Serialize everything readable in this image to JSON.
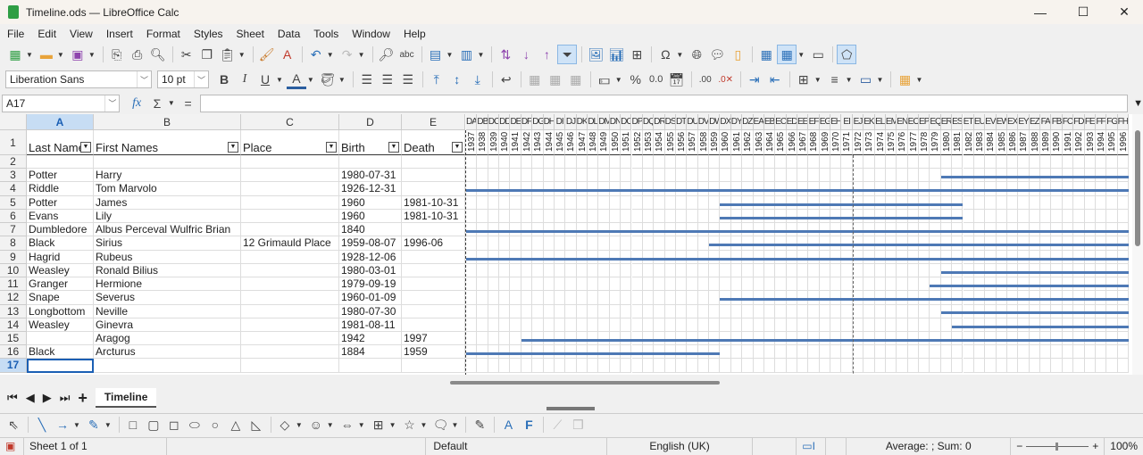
{
  "window": {
    "title": "Timeline.ods — LibreOffice Calc",
    "minimize": "—",
    "maximize": "☐",
    "close": "✕"
  },
  "menu": [
    "File",
    "Edit",
    "View",
    "Insert",
    "Format",
    "Styles",
    "Sheet",
    "Data",
    "Tools",
    "Window",
    "Help"
  ],
  "toolbar": {
    "font_name": "Liberation Sans",
    "font_size": "10 pt"
  },
  "formula_bar": {
    "name_box": "A17",
    "fx": "fx",
    "sigma": "Σ",
    "equals": "=",
    "content": ""
  },
  "columns": [
    {
      "letter": "A",
      "width": 75,
      "header": "Last Name"
    },
    {
      "letter": "B",
      "width": 165,
      "header": "First Names"
    },
    {
      "letter": "C",
      "width": 110,
      "header": "Place"
    },
    {
      "letter": "D",
      "width": 70,
      "header": "Birth"
    },
    {
      "letter": "E",
      "width": 71,
      "header": "Death"
    }
  ],
  "timeline": {
    "column_letters": [
      "DA",
      "DB",
      "DC",
      "DD",
      "DE",
      "DF",
      "DG",
      "DH",
      "DI",
      "DJ",
      "DK",
      "DL",
      "DM",
      "DN",
      "DO",
      "DP",
      "DQ",
      "DR",
      "DS",
      "DT",
      "DU",
      "DV",
      "DW",
      "DX",
      "DY",
      "DZ",
      "EA",
      "EB",
      "EC",
      "ED",
      "EE",
      "EF",
      "EG",
      "EH",
      "EI",
      "EJ",
      "EK",
      "EL",
      "EM",
      "EN",
      "EO",
      "EP",
      "EQ",
      "ER",
      "ES",
      "ET",
      "EU",
      "EV",
      "EW",
      "EX",
      "EY",
      "EZ",
      "FA",
      "FB",
      "FC",
      "FD",
      "FE",
      "FF",
      "FG",
      "FH"
    ],
    "years": [
      "1937",
      "1938",
      "1939",
      "1940",
      "1941",
      "1942",
      "1943",
      "1944",
      "1945",
      "1946",
      "1947",
      "1948",
      "1949",
      "1950",
      "1951",
      "1952",
      "1953",
      "1954",
      "1955",
      "1956",
      "1957",
      "1958",
      "1959",
      "1960",
      "1961",
      "1962",
      "1963",
      "1964",
      "1965",
      "1966",
      "1967",
      "1968",
      "1969",
      "1970",
      "1971",
      "1972",
      "1973",
      "1974",
      "1975",
      "1976",
      "1977",
      "1978",
      "1979",
      "1980",
      "1981",
      "1982",
      "1983",
      "1984",
      "1985",
      "1986",
      "1987",
      "1988",
      "1989",
      "1990",
      "1991",
      "1992",
      "1993",
      "1994",
      "1995",
      "1996"
    ],
    "bar_color": "#4e79b5",
    "marker_year": "1972"
  },
  "rows": [
    {
      "num": "2",
      "cells": [
        "",
        "",
        "",
        "",
        ""
      ]
    },
    {
      "num": "3",
      "cells": [
        "Potter",
        "Harry",
        "",
        "1980-07-31",
        ""
      ]
    },
    {
      "num": "4",
      "cells": [
        "Riddle",
        "Tom Marvolo",
        "",
        "1926-12-31",
        ""
      ]
    },
    {
      "num": "5",
      "cells": [
        "Potter",
        "James",
        "",
        "1960",
        "1981-10-31"
      ]
    },
    {
      "num": "6",
      "cells": [
        "Evans",
        "Lily",
        "",
        "1960",
        "1981-10-31"
      ]
    },
    {
      "num": "7",
      "cells": [
        "Dumbledore",
        "Albus Perceval Wulfric Brian",
        "",
        "1840",
        ""
      ]
    },
    {
      "num": "8",
      "cells": [
        "Black",
        "Sirius",
        "12 Grimauld Place",
        "1959-08-07",
        "1996-06"
      ]
    },
    {
      "num": "9",
      "cells": [
        "Hagrid",
        "Rubeus",
        "",
        "1928-12-06",
        ""
      ]
    },
    {
      "num": "10",
      "cells": [
        "Weasley",
        "Ronald Bilius",
        "",
        "1980-03-01",
        ""
      ]
    },
    {
      "num": "11",
      "cells": [
        "Granger",
        "Hermione",
        "",
        "1979-09-19",
        ""
      ]
    },
    {
      "num": "12",
      "cells": [
        "Snape",
        "Severus",
        "",
        "1960-01-09",
        ""
      ]
    },
    {
      "num": "13",
      "cells": [
        "Longbottom",
        "Neville",
        "",
        "1980-07-30",
        ""
      ]
    },
    {
      "num": "14",
      "cells": [
        "Weasley",
        "Ginevra",
        "",
        "1981-08-11",
        ""
      ]
    },
    {
      "num": "15",
      "cells": [
        "",
        "Aragog",
        "",
        "1942",
        "1997"
      ]
    },
    {
      "num": "16",
      "cells": [
        "Black",
        "Arcturus",
        "",
        "1884",
        "1959"
      ]
    },
    {
      "num": "17",
      "cells": [
        "",
        "",
        "",
        "",
        ""
      ]
    }
  ],
  "selected_cell": "A17",
  "sheet_tabs": {
    "nav": [
      "⏮",
      "◀",
      "▶",
      "⏭",
      "+"
    ],
    "active": "Timeline"
  },
  "status": {
    "sheet": "Sheet 1 of 1",
    "style": "Default",
    "language": "English (UK)",
    "summary": "Average: ; Sum: 0",
    "zoom": "100%",
    "zoom_minus": "−",
    "zoom_plus": "+"
  }
}
